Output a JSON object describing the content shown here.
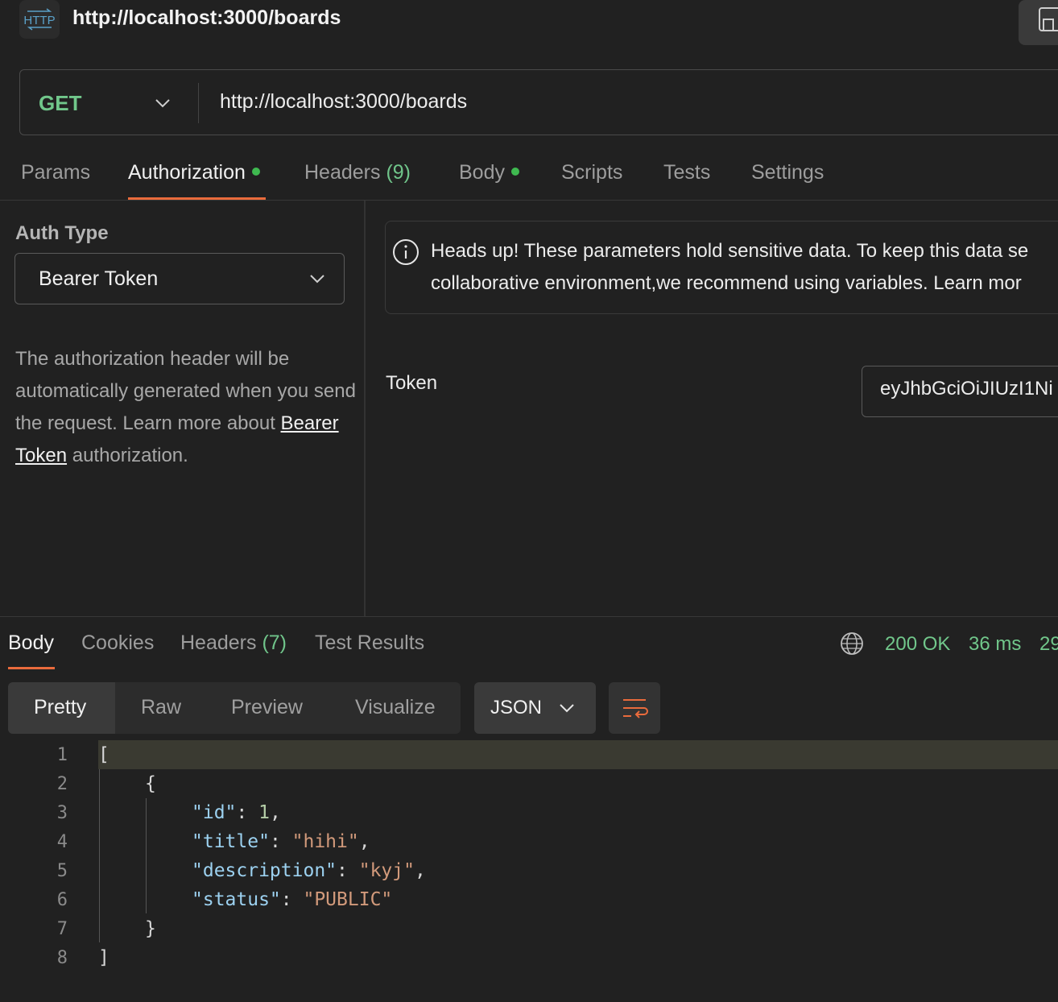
{
  "header": {
    "icon_label": "HTTP",
    "title": "http://localhost:3000/boards"
  },
  "request": {
    "method": "GET",
    "url": "http://localhost:3000/boards"
  },
  "request_tabs": [
    {
      "label": "Params"
    },
    {
      "label": "Authorization",
      "active": true
    },
    {
      "label": "Headers",
      "count": "(9)"
    },
    {
      "label": "Body"
    },
    {
      "label": "Scripts"
    },
    {
      "label": "Tests"
    },
    {
      "label": "Settings"
    }
  ],
  "auth": {
    "type_label": "Auth Type",
    "type_value": "Bearer Token",
    "desc_before": "The authorization header will be automatically generated when you send the request. Learn more about ",
    "desc_link": "Bearer Token",
    "desc_after": " authorization.",
    "notice_line1": "Heads up! These parameters hold sensitive data. To keep this data se",
    "notice_line2": "collaborative environment,we recommend using variables. Learn mor",
    "token_label": "Token",
    "token_value": "eyJhbGciOiJIUzI1Ni"
  },
  "response_tabs": [
    {
      "label": "Body",
      "active": true
    },
    {
      "label": "Cookies"
    },
    {
      "label": "Headers",
      "count": "(7)"
    },
    {
      "label": "Test Results"
    }
  ],
  "response_status": {
    "code": "200 OK",
    "time": "36 ms",
    "size": "29"
  },
  "format": {
    "modes": [
      "Pretty",
      "Raw",
      "Preview",
      "Visualize"
    ],
    "language": "JSON"
  },
  "code_lines": {
    "numbers": [
      "1",
      "2",
      "3",
      "4",
      "5",
      "6",
      "7",
      "8"
    ],
    "l1": "[",
    "l2": "{",
    "l3_key": "\"id\"",
    "l3_val": "1",
    "l4_key": "\"title\"",
    "l4_val": "\"hihi\"",
    "l5_key": "\"description\"",
    "l5_val": "\"kyj\"",
    "l6_key": "\"status\"",
    "l6_val": "\"PUBLIC\"",
    "l7": "}",
    "l8": "]"
  },
  "colors": {
    "accent": "#ea6b3c",
    "method_green": "#71c78b",
    "dot_green": "#3fb950"
  }
}
